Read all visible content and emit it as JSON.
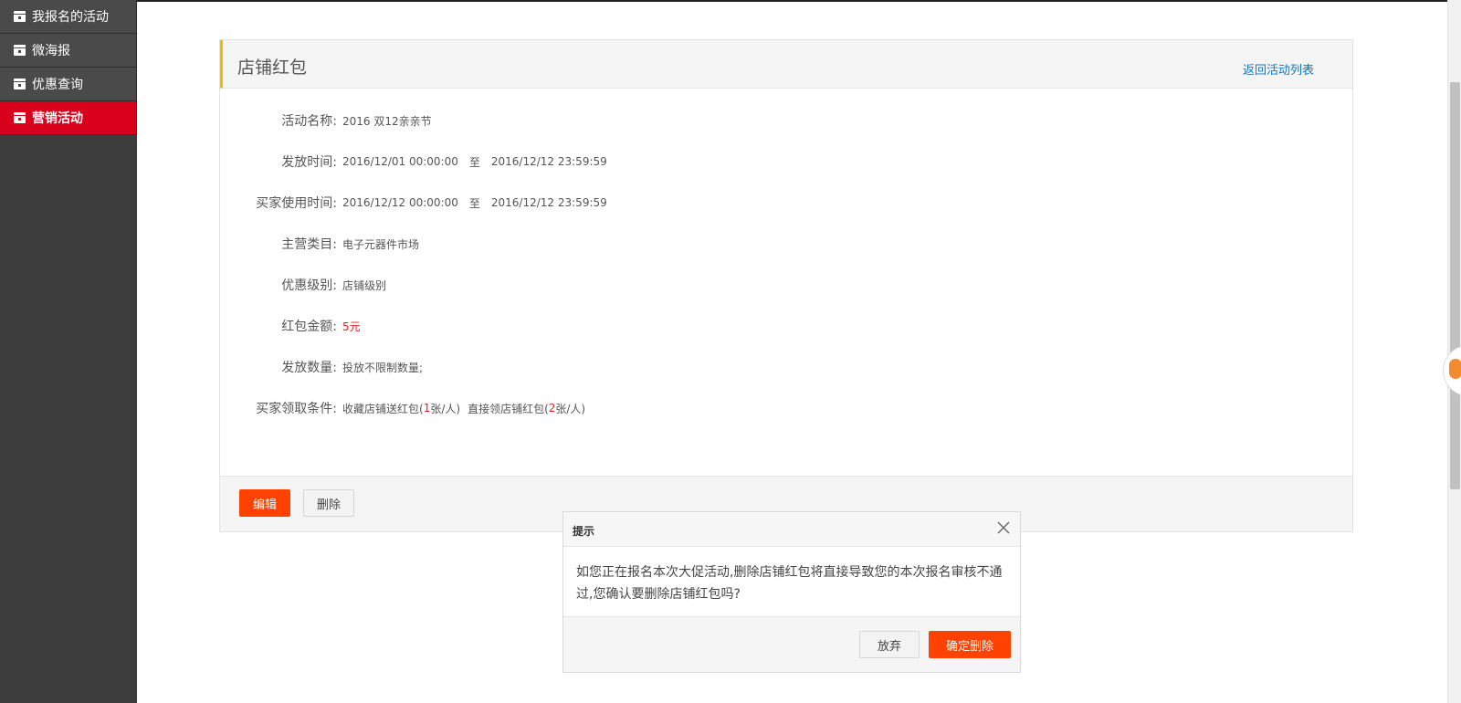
{
  "sidebar": {
    "items": [
      {
        "label": "我报名的活动",
        "icon": "calendar-icon",
        "active": false
      },
      {
        "label": "微海报",
        "icon": "calendar-icon",
        "active": false
      },
      {
        "label": "优惠查询",
        "icon": "calendar-icon",
        "active": false
      },
      {
        "label": "营销活动",
        "icon": "calendar-icon",
        "active": true
      }
    ]
  },
  "panel": {
    "title": "店铺红包",
    "back_link": "返回活动列表",
    "fields": {
      "name": {
        "label": "活动名称:",
        "value": "2016 双12亲亲节"
      },
      "issue_time": {
        "label": "发放时间:",
        "start": "2016/12/01 00:00:00",
        "sep": "至",
        "end": "2016/12/12 23:59:59"
      },
      "use_time": {
        "label": "买家使用时间:",
        "start": "2016/12/12 00:00:00",
        "sep": "至",
        "end": "2016/12/12 23:59:59"
      },
      "category": {
        "label": "主营类目:",
        "value": "电子元器件市场"
      },
      "level": {
        "label": "优惠级别:",
        "value": "店铺级别"
      },
      "amount": {
        "label": "红包金额:",
        "value": "5元"
      },
      "quantity": {
        "label": "发放数量:",
        "value": "投放不限制数量;"
      },
      "conditions": {
        "label": "买家领取条件:",
        "a_pre": "收藏店铺送红包(",
        "a_num": "1",
        "a_post": "张/人)",
        "b_pre": "直接领店铺红包(",
        "b_num": "2",
        "b_post": "张/人)"
      }
    },
    "edit_button": "编辑",
    "delete_button": "删除"
  },
  "dialog": {
    "title": "提示",
    "message": "如您正在报名本次大促活动,删除店铺红包将直接导致您的本次报名审核不通过,您确认要删除店铺红包吗?",
    "cancel_button": "放弃",
    "confirm_button": "确定删除"
  },
  "colors": {
    "accent": "#ff4200",
    "active_nav": "#d9001b",
    "link": "#0a79c8",
    "header_bar": "#f5b800"
  }
}
